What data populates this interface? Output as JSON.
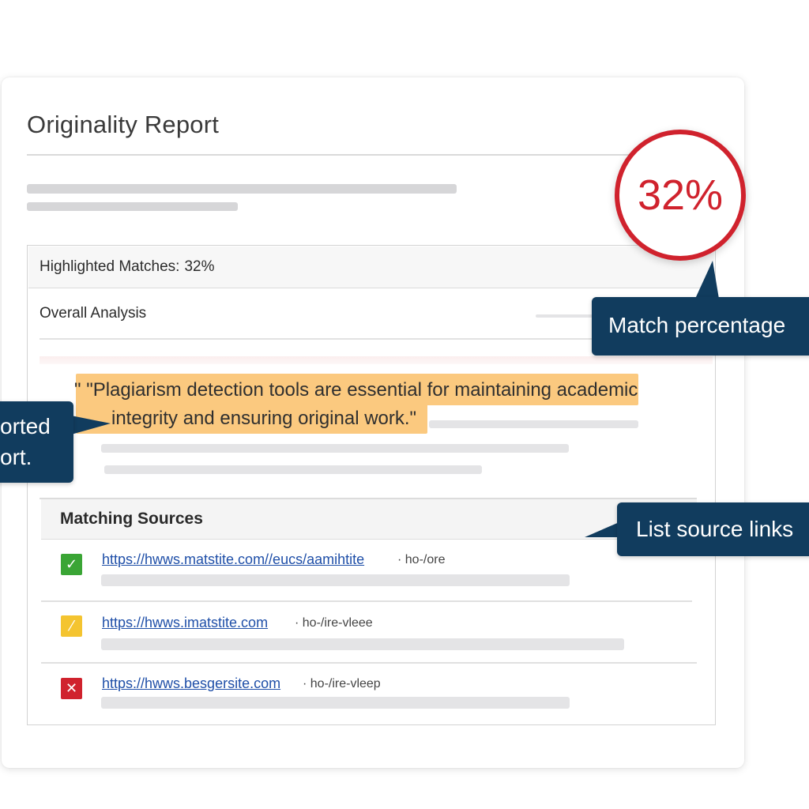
{
  "report": {
    "title": "Originality Report",
    "highlighted_label": "Highlighted Matches:",
    "highlighted_value": "32%",
    "overall_label": "Overall Analysis",
    "quote_line1": "\" \"Plagiarism detection tools are essential for maintaining academic",
    "quote_line2": "integrity and ensuring original work.\"",
    "sources_title": "Matching Sources"
  },
  "badge": {
    "value": "32%",
    "color": "#d0222d"
  },
  "callouts": {
    "match_percentage": "Match percentage",
    "list_source_links": "List source links",
    "left_line1": "orted",
    "left_line2": "ort."
  },
  "sources": [
    {
      "status": "match",
      "icon": "check-icon",
      "icon_glyph": "✓",
      "color": "#3aa535",
      "url": "https://hwws.matstite.com//eucs/aamihtite",
      "meta": "· ho-/ore"
    },
    {
      "status": "partial",
      "icon": "warning-icon",
      "icon_glyph": "⁄",
      "color": "#f4c430",
      "url": "https://hwws.imatstite.com",
      "meta": "· ho-/ire-vleee"
    },
    {
      "status": "no-match",
      "icon": "x-icon",
      "icon_glyph": "✕",
      "color": "#d0222d",
      "url": "https://hwws.besgersite.com",
      "meta": "· ho-/ire-vleep"
    }
  ],
  "colors": {
    "accent_navy": "#113c5e",
    "highlight": "#fbc97f",
    "link": "#1f4fa8"
  }
}
